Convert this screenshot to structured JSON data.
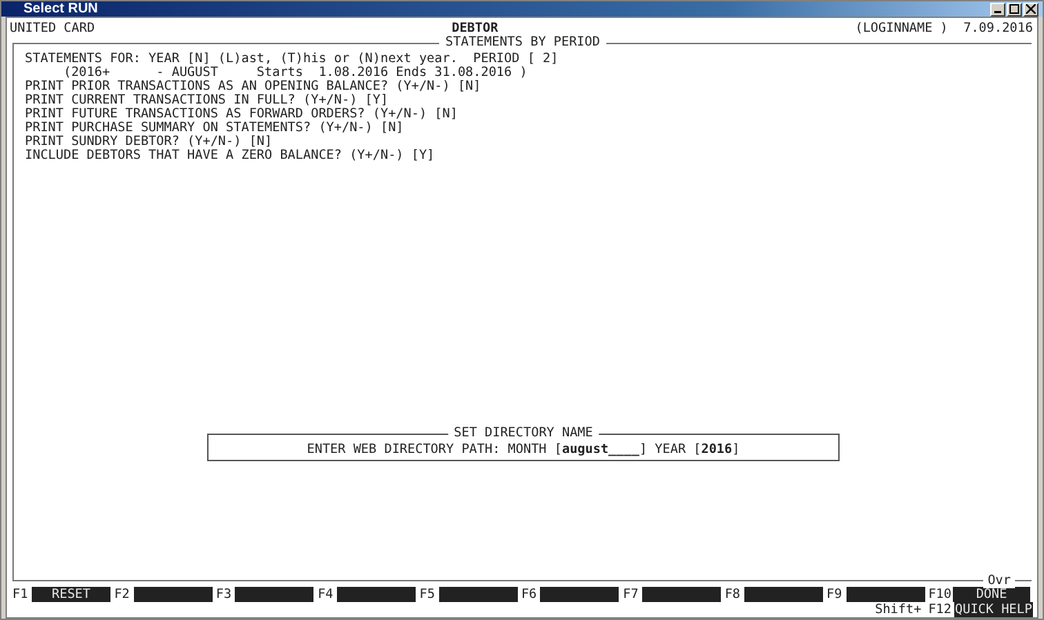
{
  "window": {
    "title": "Select RUN"
  },
  "header": {
    "left": "UNITED CARD",
    "center": "DEBTOR",
    "right": "(LOGINNAME )  7.09.2016"
  },
  "panel": {
    "title": "STATEMENTS BY PERIOD",
    "status": "Ovr",
    "lines": [
      "STATEMENTS FOR: YEAR [N] (L)ast, (T)his or (N)next year.  PERIOD [ 2]",
      "     (2016+      - AUGUST     Starts  1.08.2016 Ends 31.08.2016 )",
      "PRINT PRIOR TRANSACTIONS AS AN OPENING BALANCE? (Y+/N-) [N]",
      "PRINT CURRENT TRANSACTIONS IN FULL? (Y+/N-) [Y]",
      "PRINT FUTURE TRANSACTIONS AS FORWARD ORDERS? (Y+/N-) [N]",
      "PRINT PURCHASE SUMMARY ON STATEMENTS? (Y+/N-) [N]",
      "PRINT SUNDRY DEBTOR? (Y+/N-) [N]",
      "INCLUDE DEBTORS THAT HAVE A ZERO BALANCE? (Y+/N-) [Y]"
    ]
  },
  "dialog": {
    "title": "SET DIRECTORY NAME",
    "prompt": "ENTER WEB DIRECTORY PATH: MONTH [",
    "month": "august____",
    "middle": "] YEAR [",
    "year": "2016",
    "end": "]"
  },
  "function_keys": [
    {
      "key": "F1",
      "label": "RESET"
    },
    {
      "key": "F2"
    },
    {
      "key": "F3"
    },
    {
      "key": "F4"
    },
    {
      "key": "F5"
    },
    {
      "key": "F6"
    },
    {
      "key": "F7"
    },
    {
      "key": "F8"
    },
    {
      "key": "F9"
    },
    {
      "key": "F10",
      "label": "DONE"
    }
  ],
  "shift_keys": {
    "modifier": "Shift+",
    "key": "F12",
    "label": "QUICK HELP"
  }
}
